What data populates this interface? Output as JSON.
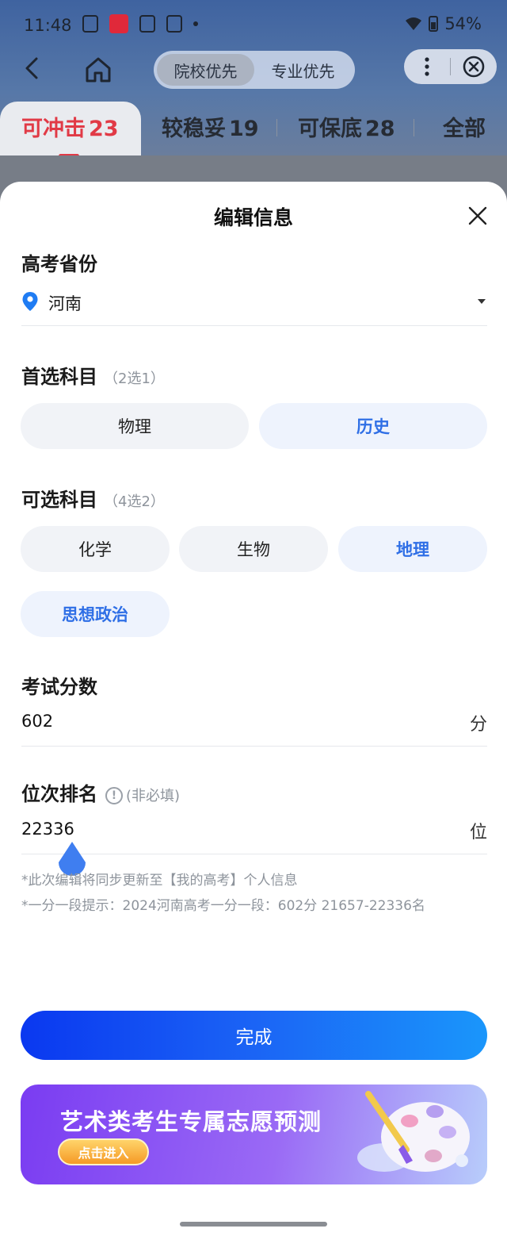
{
  "status_bar": {
    "time": "11:48",
    "battery": "54%"
  },
  "nav": {
    "segments": [
      "院校优先",
      "专业优先"
    ],
    "active_segment": "院校优先"
  },
  "tabs": [
    {
      "label": "可冲击",
      "count": "23",
      "active": true
    },
    {
      "label": "较稳妥",
      "count": "19",
      "active": false
    },
    {
      "label": "可保底",
      "count": "28",
      "active": false
    },
    {
      "label": "全部",
      "count": "",
      "active": false
    }
  ],
  "sheet": {
    "title": "编辑信息",
    "province": {
      "label": "高考省份",
      "value": "河南"
    },
    "first_subject": {
      "label": "首选科目",
      "hint": "（2选1）",
      "options": [
        {
          "label": "物理",
          "selected": false
        },
        {
          "label": "历史",
          "selected": true
        }
      ]
    },
    "optional_subject": {
      "label": "可选科目",
      "hint": "（4选2）",
      "options": [
        {
          "label": "化学",
          "selected": false
        },
        {
          "label": "生物",
          "selected": false
        },
        {
          "label": "地理",
          "selected": true
        },
        {
          "label": "思想政治",
          "selected": true
        }
      ]
    },
    "score": {
      "label": "考试分数",
      "value": "602",
      "unit": "分"
    },
    "rank": {
      "label": "位次排名",
      "hint": "(非必填)",
      "value": "22336",
      "unit": "位"
    },
    "notes": [
      "*此次编辑将同步更新至【我的高考】个人信息",
      "*一分一段提示：2024河南高考一分一段：602分 21657-22336名"
    ],
    "done_label": "完成",
    "banner": {
      "title": "艺术类考生专属志愿预测",
      "button_label": "点击进入"
    }
  },
  "colors": {
    "accent_blue": "#2f6fe6",
    "tab_active_red": "#e13a46",
    "selected_pill_bg": "#eef3fd"
  }
}
